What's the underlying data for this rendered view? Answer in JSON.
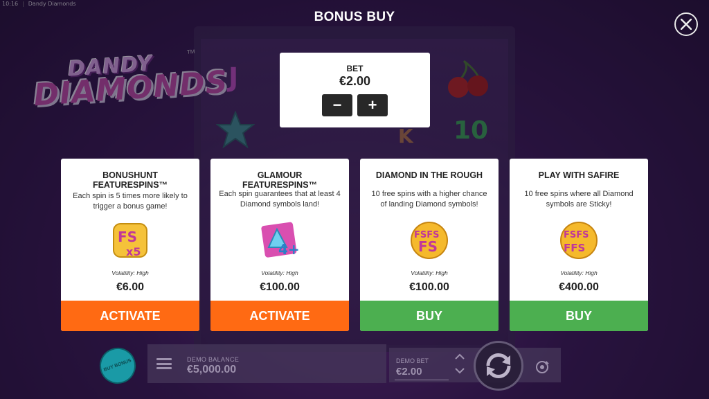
{
  "statusbar": {
    "time": "10:16",
    "app_name": "Dandy Diamonds"
  },
  "logo": {
    "line1": "DANDY",
    "line2": "DIAMONDS",
    "tm": "TM"
  },
  "dialog": {
    "title": "BONUS BUY"
  },
  "bet": {
    "label": "BET",
    "value": "€2.00",
    "minus": "−",
    "plus": "+"
  },
  "cards": [
    {
      "title": "BONUSHUNT FEATURESPINS™",
      "description": "Each spin is 5 times more likely to trigger a bonus game!",
      "volatility": "Volatility: High",
      "price": "€6.00",
      "action": "ACTIVATE",
      "icon": "fs-x5-icon"
    },
    {
      "title": "GLAMOUR FEATURESPINS™",
      "description": "Each spin guarantees that at least 4 Diamond symbols land!",
      "volatility": "Volatility: High",
      "price": "€100.00",
      "action": "ACTIVATE",
      "icon": "diamond-4plus-icon"
    },
    {
      "title": "DIAMOND IN THE ROUGH",
      "description": "10 free spins with a higher chance of landing Diamond symbols!",
      "volatility": "Volatility: High",
      "price": "€100.00",
      "action": "BUY",
      "icon": "fs-triple-icon"
    },
    {
      "title": "PLAY WITH SAFIRE",
      "description": "10 free spins where all Diamond symbols are Sticky!",
      "volatility": "Volatility: High",
      "price": "€400.00",
      "action": "BUY",
      "icon": "fs-quad-icon"
    }
  ],
  "bottom": {
    "buy_bonus": "BUY BONUS",
    "balance_label": "DEMO BALANCE",
    "balance_value": "€5,000.00",
    "bet_label": "DEMO BET",
    "bet_value": "€2.00"
  },
  "colors": {
    "activate": "#ff6a13",
    "buy": "#4caf50"
  }
}
